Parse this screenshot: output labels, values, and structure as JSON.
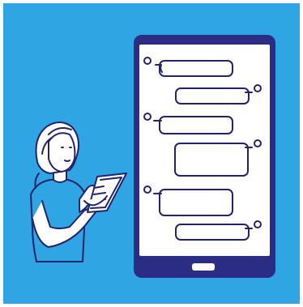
{
  "illustration": {
    "subject": "person-holding-phone-with-chat",
    "colors": {
      "background": "#2fa6e3",
      "outline": "#23236b",
      "phone_body": "#2b2c83",
      "screen": "#ffffff",
      "skin": "#ffffff",
      "shirt": "#2fa6e3"
    },
    "icons": [
      "phone-icon",
      "chat-bubble-icon",
      "home-button-icon",
      "woman-figure"
    ],
    "chat": {
      "bubble_count": 6,
      "bubbles": [
        {
          "side": "left"
        },
        {
          "side": "right"
        },
        {
          "side": "left"
        },
        {
          "side": "right"
        },
        {
          "side": "left"
        },
        {
          "side": "right"
        }
      ]
    }
  }
}
